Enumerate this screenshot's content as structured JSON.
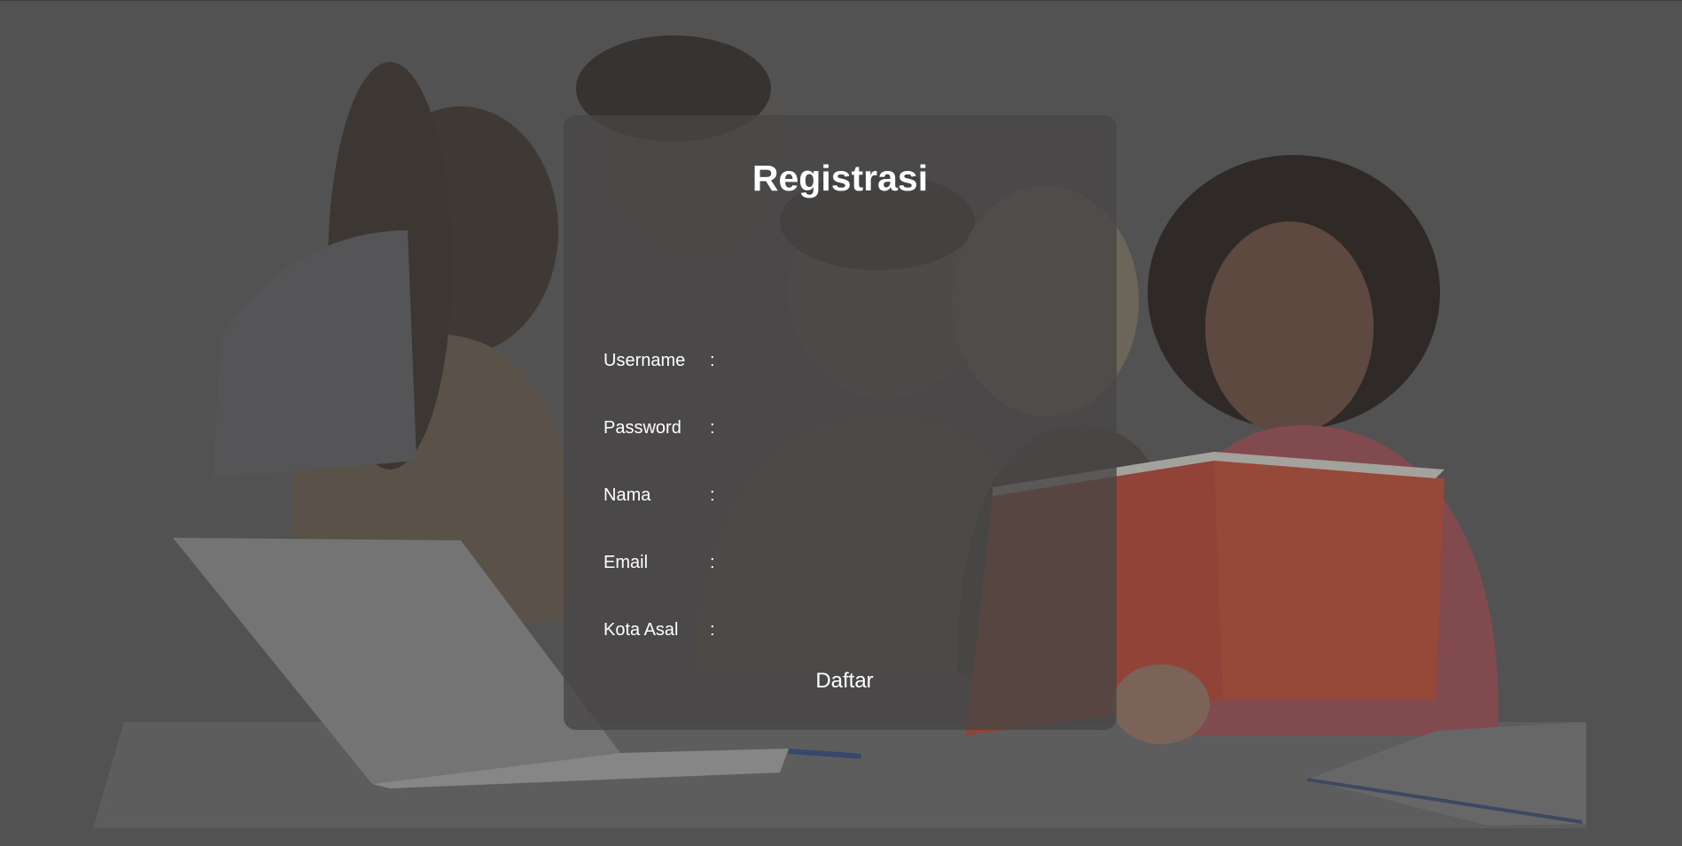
{
  "page": {
    "title": "Registrasi"
  },
  "form": {
    "fields": [
      {
        "label": "Username",
        "separator": ":",
        "value": ""
      },
      {
        "label": "Password",
        "separator": ":",
        "value": ""
      },
      {
        "label": "Nama",
        "separator": ":",
        "value": ""
      },
      {
        "label": "Email",
        "separator": ":",
        "value": ""
      },
      {
        "label": "Kota Asal",
        "separator": ":",
        "value": ""
      }
    ],
    "submit_label": "Daftar"
  },
  "colors": {
    "page_background": "#585858",
    "card_background": "#484646",
    "text": "#ffffff",
    "book_accent": "#b8432f"
  },
  "background": {
    "image": "students-studying-photo"
  }
}
